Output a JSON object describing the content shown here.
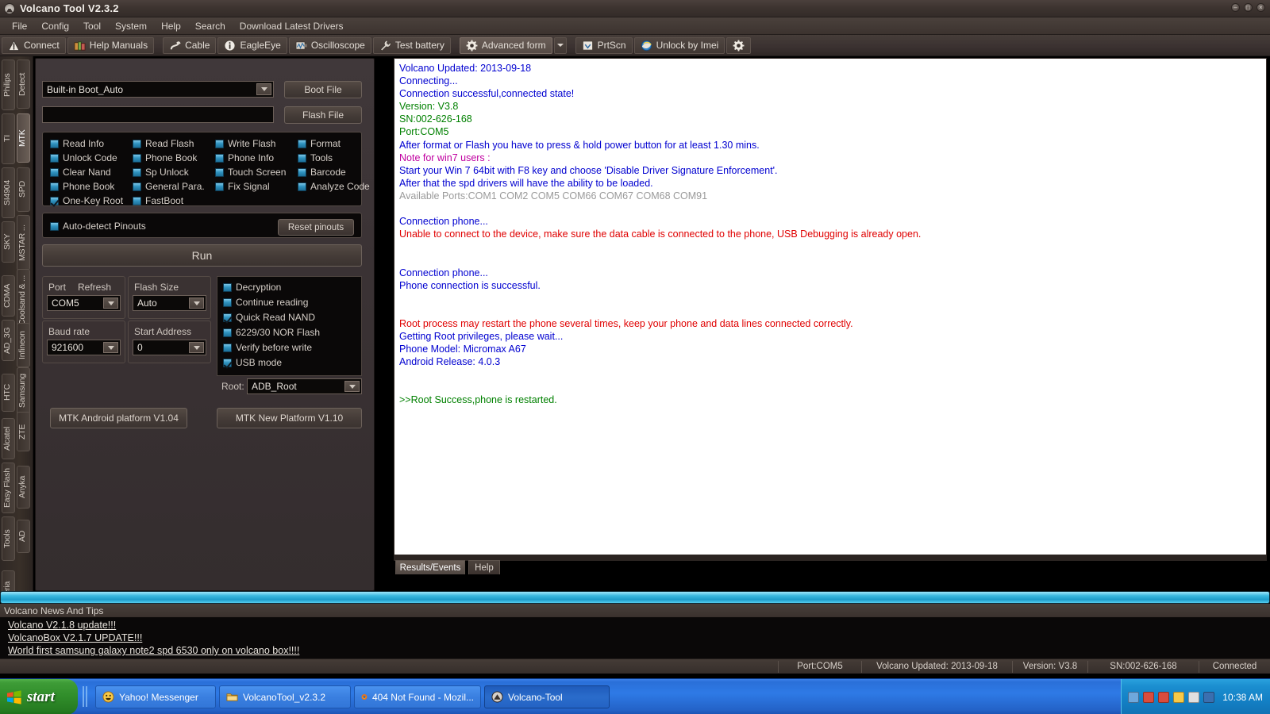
{
  "window": {
    "title": "Volcano Tool V2.3.2",
    "app_icon": "volcano-icon",
    "buttons": [
      {
        "name": "minimize-button",
        "glyph": "–"
      },
      {
        "name": "maximize-button",
        "glyph": "□"
      },
      {
        "name": "close-button",
        "glyph": "×"
      }
    ]
  },
  "menubar": {
    "items": [
      "File",
      "Config",
      "Tool",
      "System",
      "Help",
      "Search",
      "Download Latest Drivers"
    ]
  },
  "toolbar": {
    "buttons": [
      {
        "label": "Connect",
        "icon": "warning-triangle-icon",
        "pressed": false
      },
      {
        "label": "Help Manuals",
        "icon": "books-icon",
        "pressed": false
      },
      {
        "label": "Cable",
        "icon": "cable-icon",
        "pressed": false
      },
      {
        "label": "EagleEye",
        "icon": "info-circle-icon",
        "pressed": false
      },
      {
        "label": "Oscilloscope",
        "icon": "oscilloscope-icon",
        "pressed": false
      },
      {
        "label": "Test battery",
        "icon": "wrench-icon",
        "pressed": false
      },
      {
        "label": "Advanced form",
        "icon": "gear-icon",
        "pressed": true
      },
      {
        "label": "PrtScn",
        "icon": "printscreen-icon",
        "pressed": false
      },
      {
        "label": "Unlock by Imei",
        "icon": "internet-explorer-icon",
        "pressed": false
      },
      {
        "label": "",
        "icon": "settings-gear-icon",
        "pressed": false
      }
    ],
    "dropdown_caret": "chevron-down-icon"
  },
  "sidebar": {
    "outer_column": [
      "Philips",
      "TI",
      "SI4904",
      "SKY",
      "CDMA",
      "AD_3G",
      "HTC",
      "Alcatel",
      "Easy Flash",
      "Tools",
      "Xperia"
    ],
    "inner_column": [
      "Detect",
      "MTK",
      "SPD",
      "MSTAR ...",
      "Coolsand & ...",
      "Infineon",
      "Samsung",
      "ZTE",
      "Anyka",
      "AD"
    ],
    "selected": "MTK"
  },
  "left_panel": {
    "boot_combo_value": "Built-in Boot_Auto",
    "boot_file_button": "Boot File",
    "flash_file_value": "",
    "flash_file_button": "Flash File",
    "operations": [
      {
        "label": "Read Info",
        "checked": false
      },
      {
        "label": "Read Flash",
        "checked": false
      },
      {
        "label": "Write Flash",
        "checked": false
      },
      {
        "label": "Format",
        "checked": false
      },
      {
        "label": "Unlock Code",
        "checked": false
      },
      {
        "label": "Phone Book",
        "checked": false
      },
      {
        "label": "Phone Info",
        "checked": false
      },
      {
        "label": "Tools",
        "checked": false
      },
      {
        "label": "Clear Nand",
        "checked": false
      },
      {
        "label": "Sp Unlock",
        "checked": false
      },
      {
        "label": "Touch Screen",
        "checked": false
      },
      {
        "label": "Barcode",
        "checked": false
      },
      {
        "label": "Phone Book",
        "checked": false
      },
      {
        "label": "General Para.",
        "checked": false
      },
      {
        "label": "Fix Signal",
        "checked": false
      },
      {
        "label": "Analyze Code",
        "checked": false
      },
      {
        "label": "One-Key Root",
        "checked": true
      },
      {
        "label": "FastBoot",
        "checked": false
      }
    ],
    "auto_detect_pinouts": {
      "label": "Auto-detect Pinouts",
      "checked": false
    },
    "reset_pinouts_button": "Reset pinouts",
    "run_button": "Run",
    "port_label": "Port",
    "refresh_label": "Refresh",
    "port_value": "COM5",
    "flash_size_label": "Flash Size",
    "flash_size_value": "Auto",
    "baud_rate_label": "Baud rate",
    "baud_rate_value": "921600",
    "start_address_label": "Start Address",
    "start_address_value": "0",
    "options": [
      {
        "label": "Decryption",
        "checked": false
      },
      {
        "label": "Continue reading",
        "checked": false
      },
      {
        "label": "Quick Read NAND",
        "checked": true
      },
      {
        "label": "6229/30 NOR Flash",
        "checked": false
      },
      {
        "label": "Verify before write",
        "checked": false
      },
      {
        "label": "USB mode",
        "checked": true
      }
    ],
    "root_label": "Root:",
    "root_value": "ADB_Root",
    "platform_button_left": "MTK Android platform V1.04",
    "platform_button_right": "MTK New Platform V1.10"
  },
  "log": {
    "lines": [
      {
        "text": "Volcano Updated: 2013-09-18",
        "color": "#0000d0"
      },
      {
        "text": "Connecting...",
        "color": "#0000d0"
      },
      {
        "text": "Connection successful,connected state!",
        "color": "#0000d0"
      },
      {
        "text": "Version: V3.8",
        "color": "#008000"
      },
      {
        "text": "SN:002-626-168",
        "color": "#008000"
      },
      {
        "text": "Port:COM5",
        "color": "#008000"
      },
      {
        "text": "After format or Flash you have to press & hold power button for at least 1.30 mins.",
        "color": "#0000d0"
      },
      {
        "text": "Note for win7 users :",
        "color": "#c000a0"
      },
      {
        "text": "Start your Win 7 64bit with F8 key and choose 'Disable Driver Signature Enforcement'.",
        "color": "#0000d0"
      },
      {
        "text": "After that the spd drivers will have the ability to be loaded.",
        "color": "#0000d0"
      },
      {
        "text": "Available Ports:COM1 COM2 COM5 COM66 COM67 COM68 COM91",
        "color": "#9a9a9a"
      },
      {
        "text": "",
        "color": "#0000d0"
      },
      {
        "text": "Connection phone...",
        "color": "#0000d0"
      },
      {
        "text": "Unable to connect to the device, make sure the data cable is connected to the phone, USB Debugging is already open.",
        "color": "#e00000"
      },
      {
        "text": "",
        "color": "#0000d0"
      },
      {
        "text": "",
        "color": "#0000d0"
      },
      {
        "text": "Connection phone...",
        "color": "#0000d0"
      },
      {
        "text": "Phone connection is successful.",
        "color": "#0000d0"
      },
      {
        "text": "",
        "color": "#0000d0"
      },
      {
        "text": "",
        "color": "#0000d0"
      },
      {
        "text": "Root process may restart the phone several times, keep your phone and data lines connected correctly.",
        "color": "#e00000"
      },
      {
        "text": "Getting Root privileges, please wait...",
        "color": "#0000d0"
      },
      {
        "text": "Phone Model: Micromax A67",
        "color": "#0000d0"
      },
      {
        "text": "Android Release: 4.0.3",
        "color": "#0000d0"
      },
      {
        "text": "",
        "color": "#0000d0"
      },
      {
        "text": "",
        "color": "#0000d0"
      },
      {
        "text": ">>Root Success,phone is restarted.",
        "color": "#008000"
      }
    ],
    "tabs": [
      {
        "label": "Results/Events",
        "selected": true
      },
      {
        "label": "Help",
        "selected": false
      }
    ]
  },
  "news": {
    "header": "Volcano News And Tips",
    "links": [
      "Volcano V2.1.8 update!!!",
      "VolcanoBox V2.1.7 UPDATE!!!",
      "World first samsung galaxy note2 spd 6530 only on volcano box!!!!"
    ]
  },
  "statusbar": {
    "cells": [
      "Port:COM5",
      "Volcano Updated: 2013-09-18",
      "Version: V3.8",
      "SN:002-626-168",
      "Connected"
    ]
  },
  "taskbar": {
    "start_label": "start",
    "items": [
      {
        "label": "Yahoo! Messenger",
        "icon": "yahoo-messenger-icon",
        "active": false
      },
      {
        "label": "VolcanoTool_v2.3.2",
        "icon": "folder-icon",
        "active": false
      },
      {
        "label": "404 Not Found - Mozil...",
        "icon": "firefox-icon",
        "active": false
      },
      {
        "label": "Volcano-Tool",
        "icon": "volcano-icon",
        "active": true
      }
    ],
    "tray_icons": [
      "network-icon",
      "shield-icon",
      "antivirus-icon",
      "messenger-icon",
      "volume-icon",
      "usb-icon"
    ],
    "clock": "10:38 AM"
  },
  "colors": {
    "accent_cyan": "#3bb9e0",
    "panel_brown": "#3a3130",
    "checkbox_blue": "#2f93c0",
    "log_blue": "#0000d0",
    "log_green": "#008000",
    "log_red": "#e00000",
    "log_magenta": "#c000a0",
    "log_gray": "#9a9a9a",
    "taskbar_blue": "#2e7ae6",
    "start_green": "#318e2b"
  }
}
